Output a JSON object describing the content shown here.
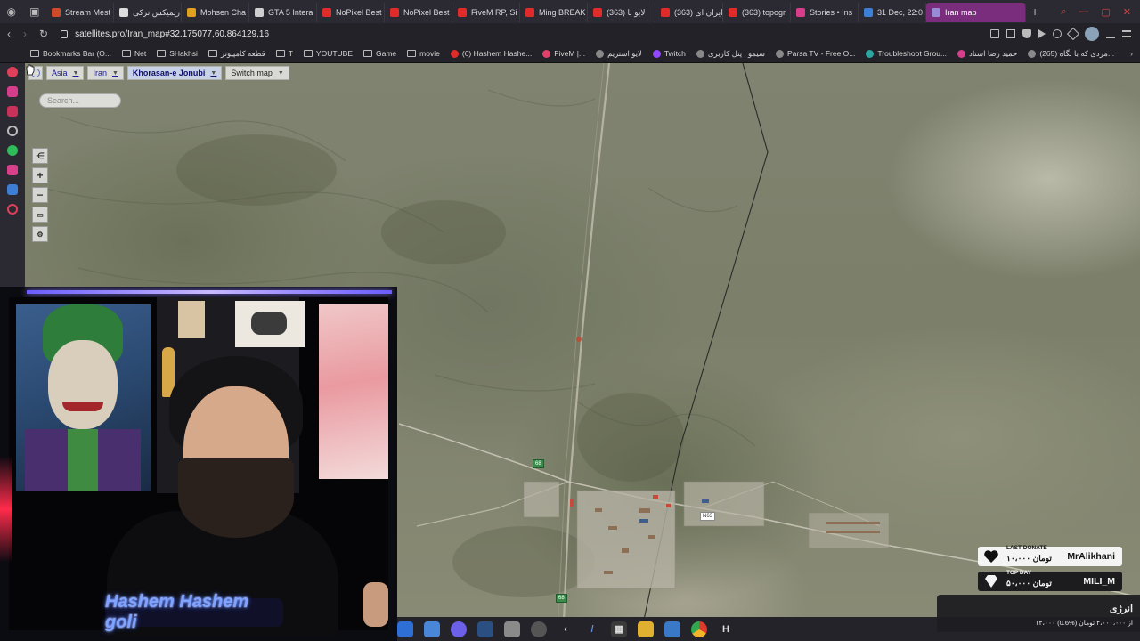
{
  "browser": {
    "tabs": [
      {
        "label": "Stream Mest",
        "color": "#d04a2a"
      },
      {
        "label": "ریمیکس ترکی",
        "color": "#dcdcdc"
      },
      {
        "label": "Mohsen Cha",
        "color": "#e0a020"
      },
      {
        "label": "GTA 5 Intera",
        "color": "#cfcfcf"
      },
      {
        "label": "NoPixel Best",
        "color": "#e02b2b"
      },
      {
        "label": "NoPixel Best",
        "color": "#e02b2b"
      },
      {
        "label": "FiveM RP, Si",
        "color": "#e02b2b"
      },
      {
        "label": "Ming BREAK",
        "color": "#e02b2b"
      },
      {
        "label": "لایو با (363)",
        "color": "#e02b2b"
      },
      {
        "label": "ایران ای (363)",
        "color": "#e02b2b"
      },
      {
        "label": "(363) topogr",
        "color": "#e02b2b"
      },
      {
        "label": "Stories • Ins",
        "color": "#d63d8a"
      },
      {
        "label": "31 Dec, 22:0",
        "color": "#3d7fd6"
      },
      {
        "label": "Iran map",
        "color": "#9a8bd6",
        "active": true
      }
    ],
    "url": "satellites.pro/Iran_map#32.175077,60.864129,16",
    "bookmarks": [
      {
        "label": "Bookmarks Bar (O...",
        "kind": "folder"
      },
      {
        "label": "Net",
        "kind": "folder"
      },
      {
        "label": "SHakhsi",
        "kind": "folder"
      },
      {
        "label": "قطعه کامپیوتر",
        "kind": "folder"
      },
      {
        "label": "T",
        "kind": "folder"
      },
      {
        "label": "YOUTUBE",
        "kind": "folder"
      },
      {
        "label": "Game",
        "kind": "folder"
      },
      {
        "label": "movie",
        "kind": "folder"
      },
      {
        "label": "(6) Hashem Hashe...",
        "kind": "yt"
      },
      {
        "label": "FiveM |...",
        "kind": "fivem"
      },
      {
        "label": "لایو استریم",
        "kind": "plain"
      },
      {
        "label": "Twitch",
        "kind": "twitch"
      },
      {
        "label": "سیمو | پنل کاربری",
        "kind": "plain"
      },
      {
        "label": "Parsa TV - Free O...",
        "kind": "plain"
      },
      {
        "label": "Troubleshoot Grou...",
        "kind": "x"
      },
      {
        "label": "حمید رضا استاد",
        "kind": "pink"
      },
      {
        "label": "(265) مردی که با نگاه...",
        "kind": "plain"
      }
    ]
  },
  "map": {
    "breadcrumbs": {
      "continent": "Asia",
      "country": "Iran",
      "region": "Khorasan-e Jonubi",
      "switch": "Switch map"
    },
    "search_placeholder": "Search...",
    "road_labels": [
      {
        "label": "68",
        "style": "green"
      },
      {
        "label": "N63",
        "style": "white"
      },
      {
        "label": "68",
        "style": "green"
      }
    ]
  },
  "webcam": {
    "name": "Hashem Hashem goli"
  },
  "alerts": {
    "last_donate": {
      "label": "LAST DONATE",
      "amount": "۱۰،۰۰۰ تومان",
      "name": "MrAlikhani"
    },
    "top_day": {
      "label": "TOP DAY",
      "amount": "۵۰،۰۰۰ تومان",
      "name": "MILI_M"
    },
    "energy": {
      "title": "انرژی",
      "progress_text": "۱۲،۰۰۰ از ۲،۰۰۰،۰۰۰ تومان (%0.6)",
      "progress": 0.006
    }
  },
  "colors": {
    "active_tab": "#7a2d7c",
    "nameplate_glow": "#3f6bff",
    "sidebar": "#2b2a33"
  }
}
